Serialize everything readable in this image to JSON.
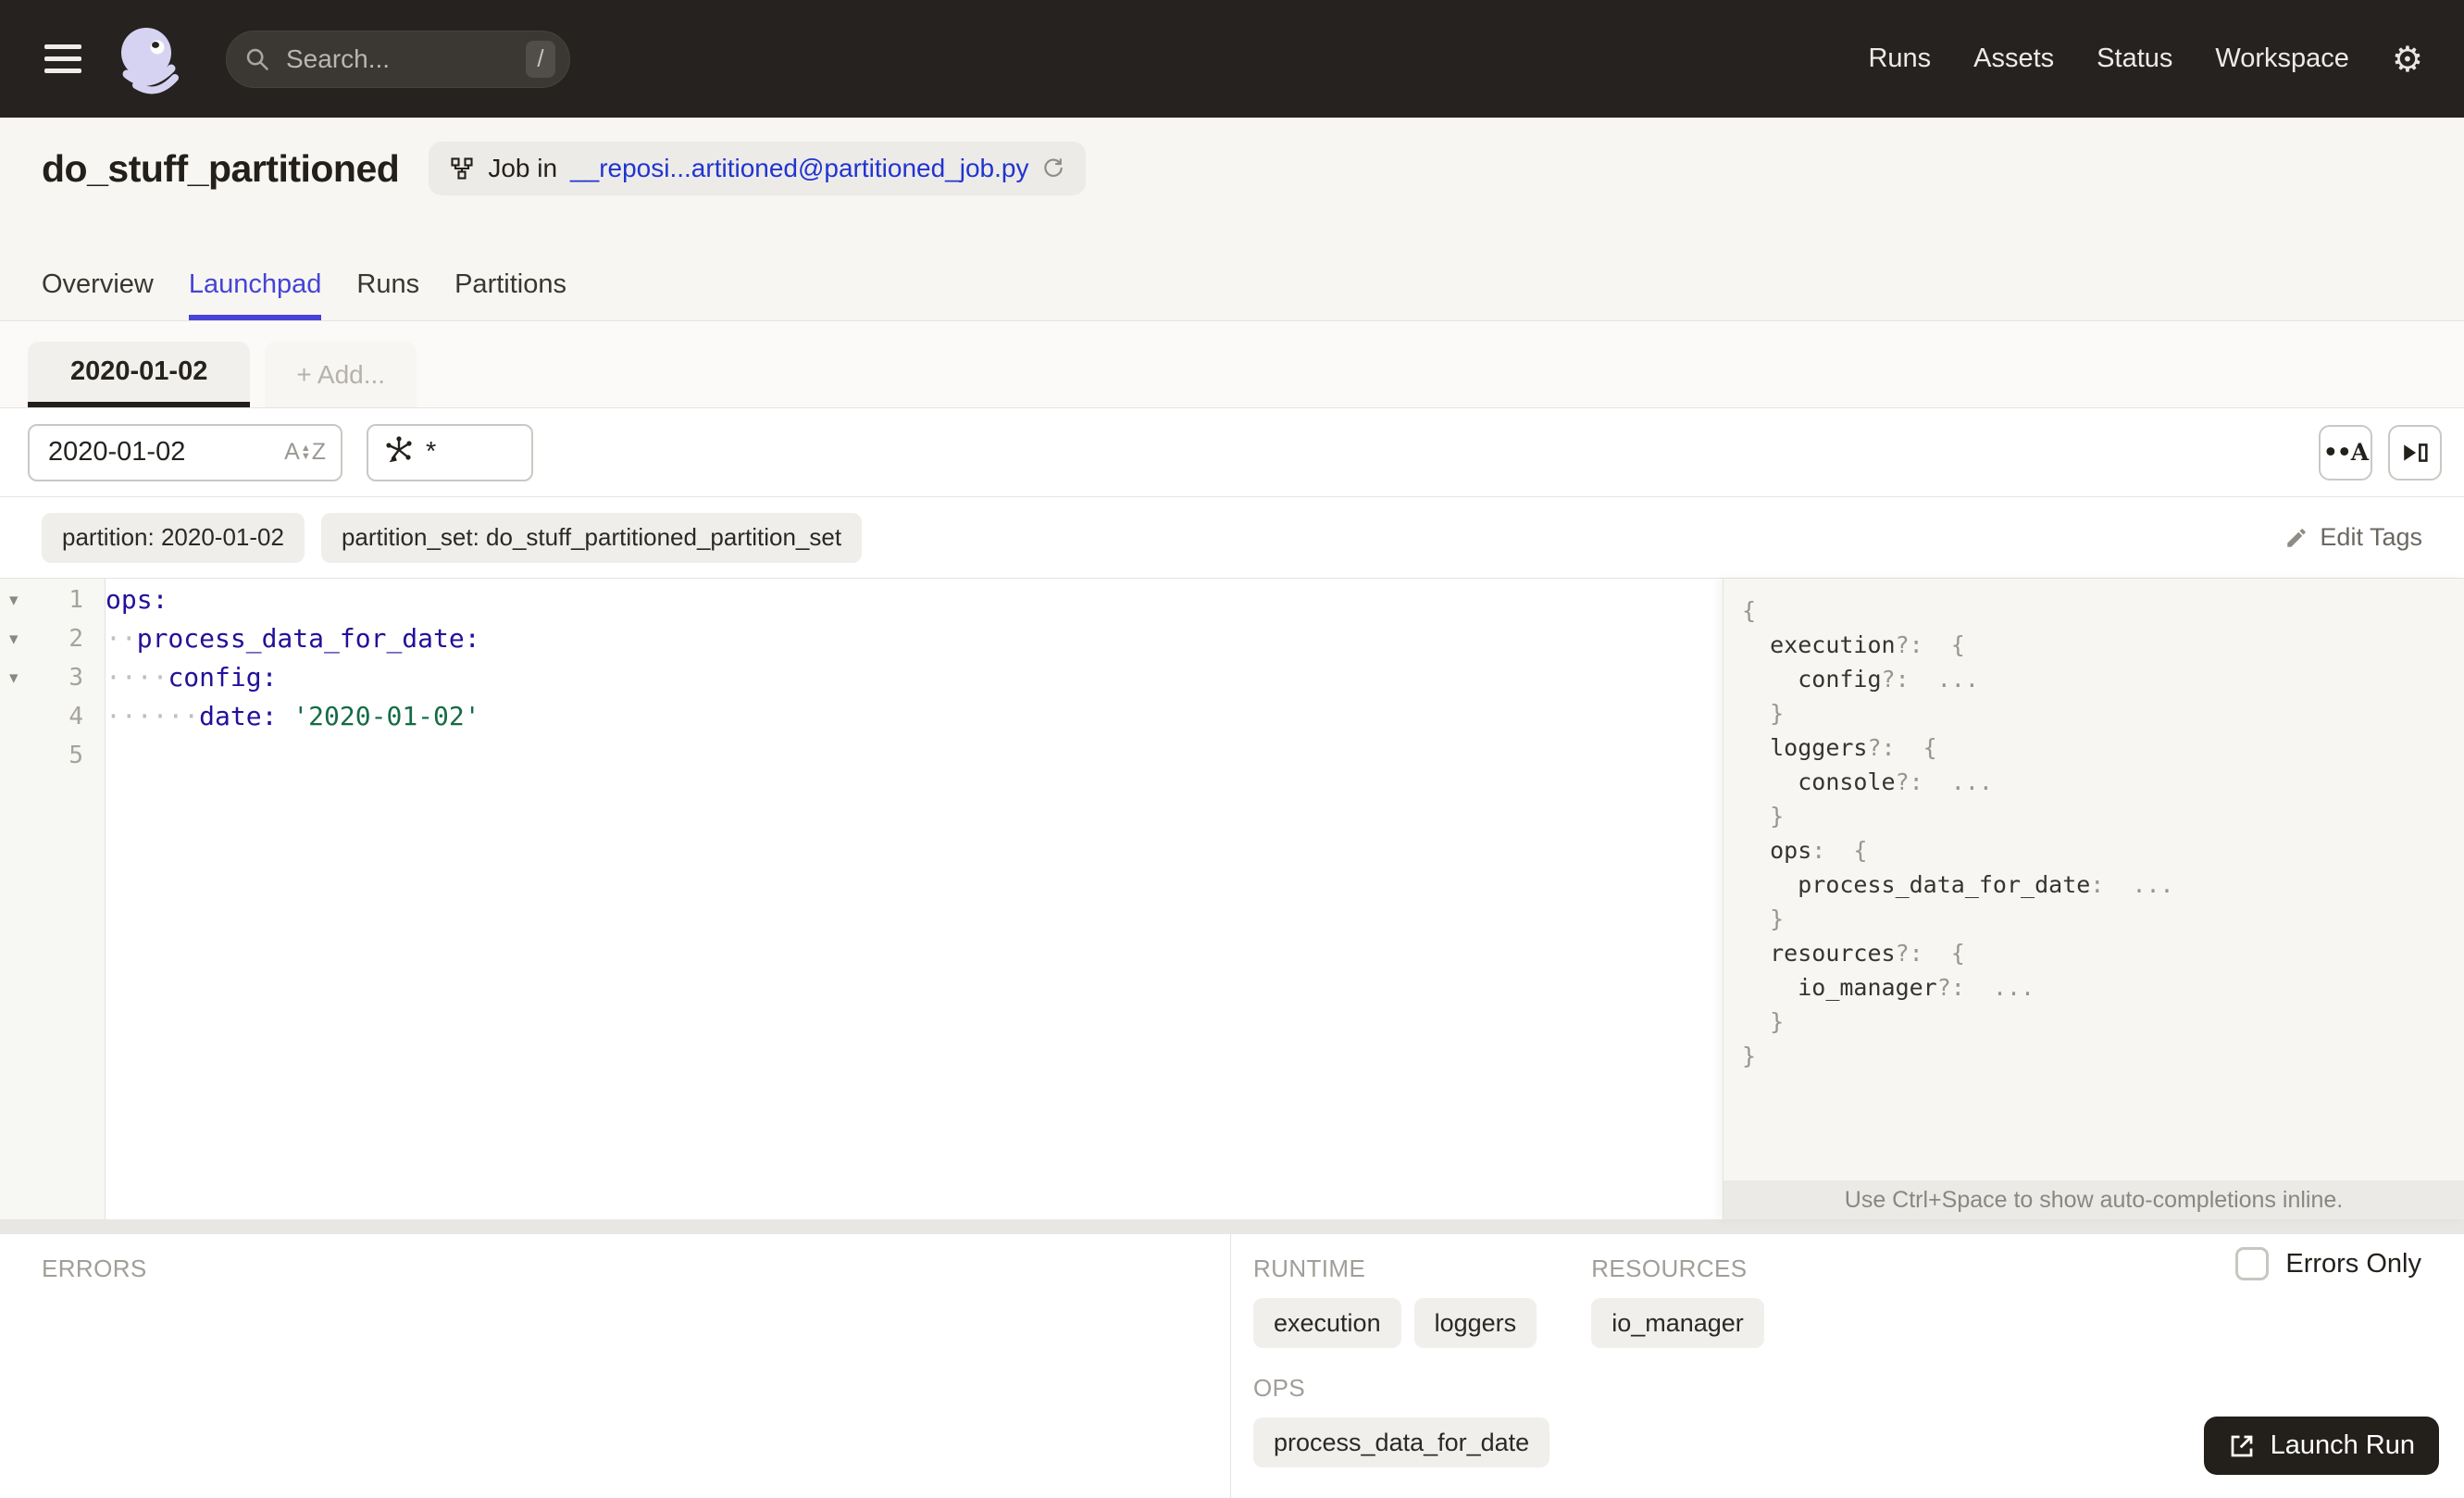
{
  "navbar": {
    "search_placeholder": "Search...",
    "search_shortcut": "/",
    "links": {
      "runs": "Runs",
      "assets": "Assets",
      "status": "Status",
      "workspace": "Workspace"
    }
  },
  "header": {
    "title": "do_stuff_partitioned",
    "badge_prefix": "Job in",
    "badge_link": "__reposi...artitioned@partitioned_job.py"
  },
  "tabs": [
    {
      "label": "Overview"
    },
    {
      "label": "Launchpad"
    },
    {
      "label": "Runs"
    },
    {
      "label": "Partitions"
    }
  ],
  "config_tabs": {
    "active_label": "2020-01-02",
    "add_label": "+ Add..."
  },
  "filters": {
    "partition_input": "2020-01-02",
    "op_selection": "*"
  },
  "editor_toolbar": {
    "whitespace_glyph": "••A"
  },
  "tags": {
    "items": [
      "partition: 2020-01-02",
      "partition_set: do_stuff_partitioned_partition_set"
    ],
    "edit_label": "Edit Tags"
  },
  "editor": {
    "fold_glyph": "▾",
    "lines": [
      {
        "num": "1",
        "fold": true,
        "segments": [
          [
            "key",
            "ops:"
          ]
        ]
      },
      {
        "num": "2",
        "fold": true,
        "segments": [
          [
            "ws",
            "··"
          ],
          [
            "key",
            "process_data_for_date:"
          ]
        ]
      },
      {
        "num": "3",
        "fold": true,
        "segments": [
          [
            "ws",
            "····"
          ],
          [
            "key",
            "config:"
          ]
        ]
      },
      {
        "num": "4",
        "fold": false,
        "segments": [
          [
            "ws",
            "······"
          ],
          [
            "key",
            "date:"
          ],
          [
            "plain",
            " "
          ],
          [
            "str",
            "'2020-01-02'"
          ]
        ]
      },
      {
        "num": "5",
        "fold": false,
        "segments": []
      }
    ]
  },
  "schema": {
    "lines": [
      {
        "segments": [
          [
            "punct",
            "{"
          ]
        ]
      },
      {
        "segments": [
          [
            "plain",
            "  "
          ],
          [
            "key",
            "execution"
          ],
          [
            "punct",
            "?:  {"
          ]
        ]
      },
      {
        "segments": [
          [
            "plain",
            "    "
          ],
          [
            "key",
            "config"
          ],
          [
            "punct",
            "?:  ..."
          ]
        ]
      },
      {
        "segments": [
          [
            "plain",
            "  "
          ],
          [
            "punct",
            "}"
          ]
        ]
      },
      {
        "segments": [
          [
            "plain",
            "  "
          ],
          [
            "key",
            "loggers"
          ],
          [
            "punct",
            "?:  {"
          ]
        ]
      },
      {
        "segments": [
          [
            "plain",
            "    "
          ],
          [
            "key",
            "console"
          ],
          [
            "punct",
            "?:  ..."
          ]
        ]
      },
      {
        "segments": [
          [
            "plain",
            "  "
          ],
          [
            "punct",
            "}"
          ]
        ]
      },
      {
        "segments": [
          [
            "plain",
            "  "
          ],
          [
            "key",
            "ops"
          ],
          [
            "punct",
            ":  {"
          ]
        ]
      },
      {
        "segments": [
          [
            "plain",
            "    "
          ],
          [
            "key",
            "process_data_for_date"
          ],
          [
            "punct",
            ":  ..."
          ]
        ]
      },
      {
        "segments": [
          [
            "plain",
            "  "
          ],
          [
            "punct",
            "}"
          ]
        ]
      },
      {
        "segments": [
          [
            "plain",
            "  "
          ],
          [
            "key",
            "resources"
          ],
          [
            "punct",
            "?:  {"
          ]
        ]
      },
      {
        "segments": [
          [
            "plain",
            "    "
          ],
          [
            "key",
            "io_manager"
          ],
          [
            "punct",
            "?:  ..."
          ]
        ]
      },
      {
        "segments": [
          [
            "plain",
            "  "
          ],
          [
            "punct",
            "}"
          ]
        ]
      },
      {
        "segments": [
          [
            "punct",
            "}"
          ]
        ]
      }
    ],
    "hint": "Use Ctrl+Space to show auto-completions inline."
  },
  "bottom": {
    "errors_label": "ERRORS",
    "runtime_label": "RUNTIME",
    "runtime_chips": [
      "execution",
      "loggers"
    ],
    "resources_label": "RESOURCES",
    "resources_chips": [
      "io_manager"
    ],
    "ops_label": "OPS",
    "ops_chips": [
      "process_data_for_date"
    ],
    "errors_only_label": "Errors Only",
    "launch_label": "Launch Run"
  }
}
